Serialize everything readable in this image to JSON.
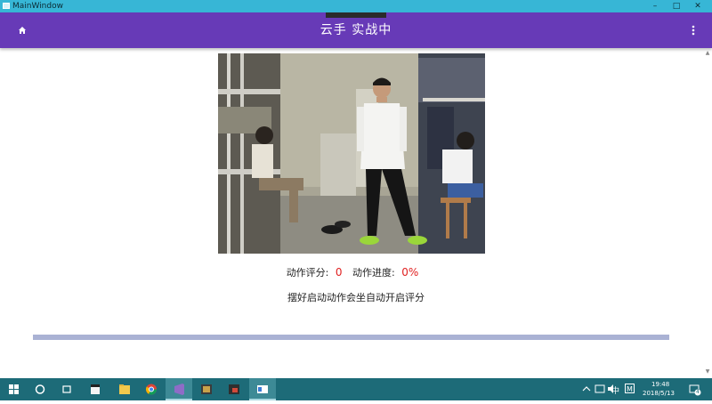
{
  "window": {
    "title": "MainWindow"
  },
  "appbar": {
    "title": "云手  实战中"
  },
  "score": {
    "label_score": "动作评分:",
    "value_score": "0",
    "label_progress": "动作进度:",
    "value_progress": "0%",
    "hint": "摆好启动动作会坐自动开启评分",
    "progress_fraction": 0
  },
  "taskbar": {
    "ime_label": "中",
    "m_label": "M",
    "time": "19:48",
    "date": "2018/5/13",
    "notification_count": "4"
  },
  "colors": {
    "titlebar": "#37b6d6",
    "appbar": "#673ab7",
    "accent_red": "#e02020",
    "progress_track": "#aab2d4",
    "taskbar": "#1d6b78"
  }
}
